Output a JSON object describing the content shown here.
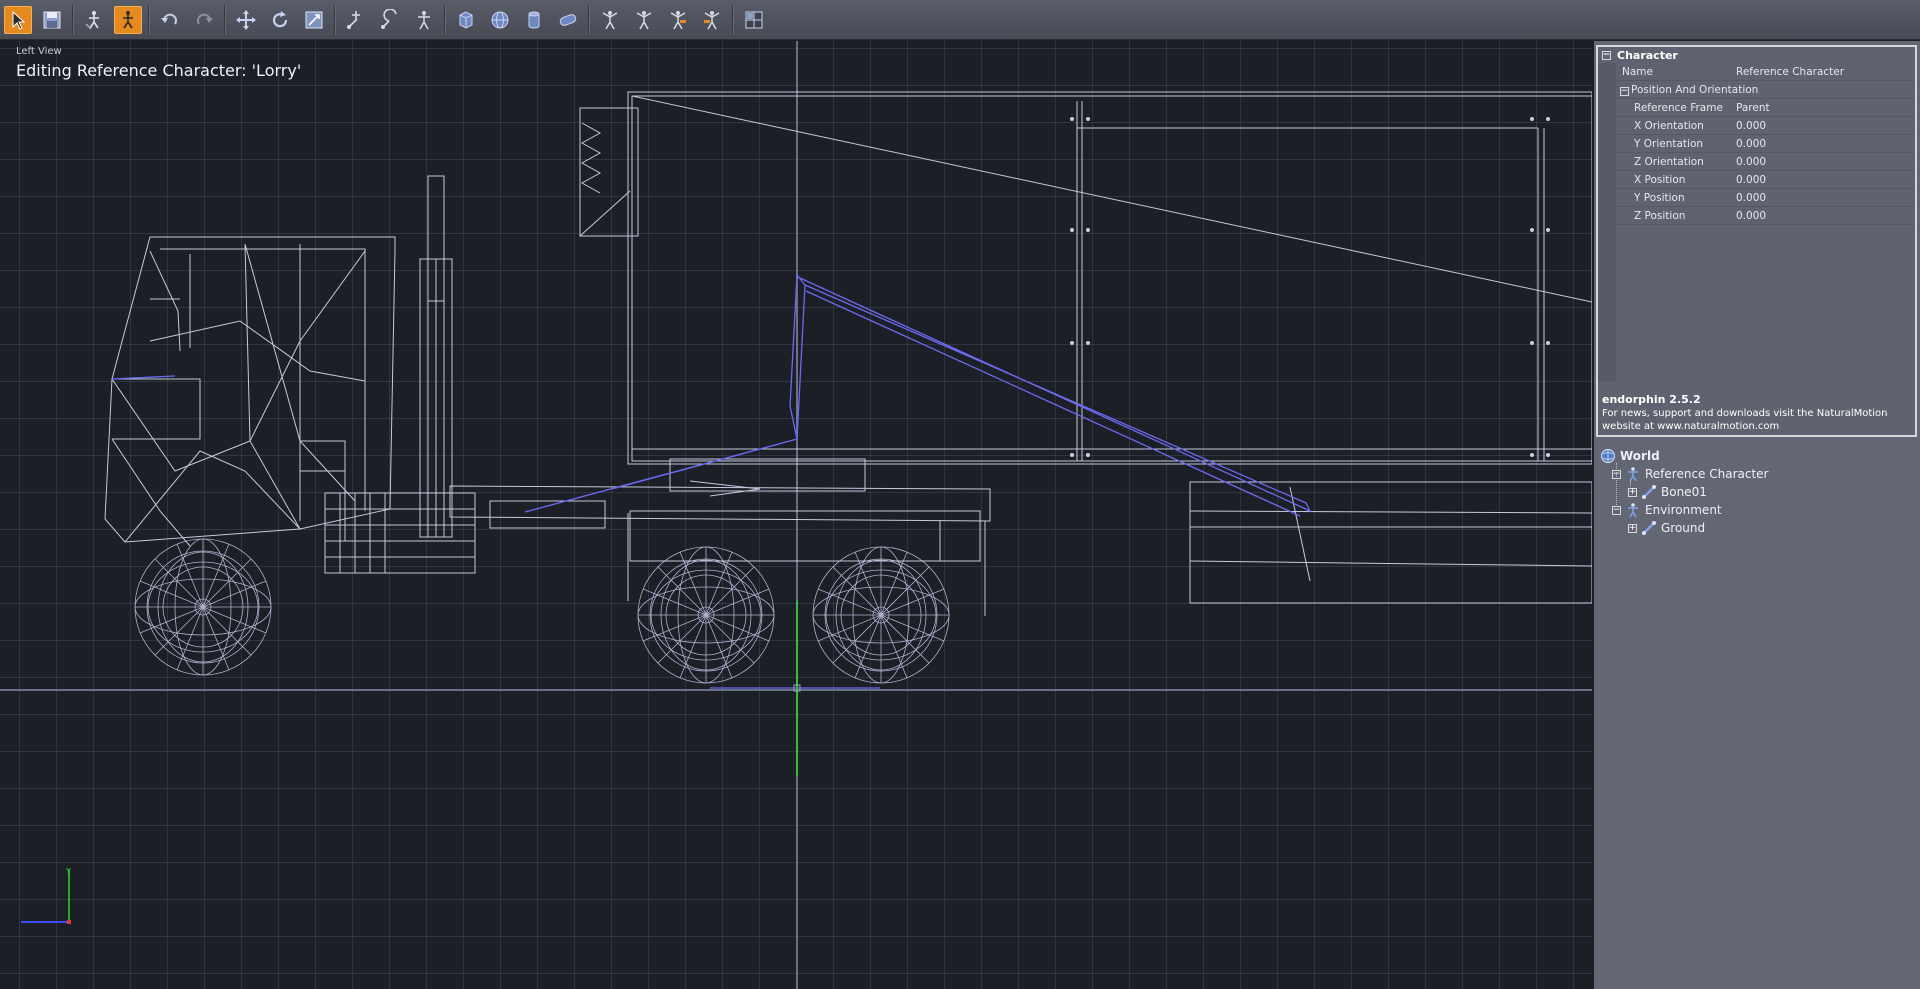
{
  "toolbar": {
    "buttons": [
      {
        "name": "select-tool-button",
        "icon": "arrow-cursor-icon",
        "active": true
      },
      {
        "name": "save-button",
        "icon": "floppy-disk-icon"
      },
      {
        "name": "character-edit-button",
        "icon": "figure-arrow-icon"
      },
      {
        "name": "reference-character-button",
        "icon": "figure-active-icon",
        "active": true
      },
      {
        "name": "undo-button",
        "icon": "undo-icon"
      },
      {
        "name": "redo-button",
        "icon": "redo-icon"
      },
      {
        "name": "translate-tool-button",
        "icon": "move-arrows-icon"
      },
      {
        "name": "rotate-tool-button",
        "icon": "rotate-icon"
      },
      {
        "name": "scale-tool-button",
        "icon": "scale-icon"
      },
      {
        "name": "bone-translate-button",
        "icon": "bone-move-icon"
      },
      {
        "name": "bone-rotate-button",
        "icon": "bone-rotate-icon"
      },
      {
        "name": "figure-pose-button",
        "icon": "figure-pose-icon"
      },
      {
        "name": "add-box-button",
        "icon": "box-icon"
      },
      {
        "name": "add-sphere-button",
        "icon": "sphere-icon"
      },
      {
        "name": "add-cylinder-button",
        "icon": "cylinder-icon"
      },
      {
        "name": "add-capsule-button",
        "icon": "capsule-icon"
      },
      {
        "name": "behaviour-1-button",
        "icon": "figure-arms-icon"
      },
      {
        "name": "behaviour-2-button",
        "icon": "figure-arms-icon"
      },
      {
        "name": "behaviour-3-button",
        "icon": "figure-arms-orange-icon"
      },
      {
        "name": "behaviour-4-button",
        "icon": "figure-arms-orange-icon"
      },
      {
        "name": "layout-button",
        "icon": "layout-icon"
      }
    ]
  },
  "viewport": {
    "view_label": "Left View",
    "title": "Editing Reference Character: 'Lorry'",
    "axis_y": "Y"
  },
  "properties": {
    "header": "Character",
    "name_label": "Name",
    "name_value": "Reference Character",
    "group_label": "Position And Orientation",
    "rows": [
      {
        "label": "Reference Frame",
        "value": "Parent"
      },
      {
        "label": "X Orientation",
        "value": "0.000"
      },
      {
        "label": "Y Orientation",
        "value": "0.000"
      },
      {
        "label": "Z Orientation",
        "value": "0.000"
      },
      {
        "label": "X Position",
        "value": "0.000"
      },
      {
        "label": "Y Position",
        "value": "0.000"
      },
      {
        "label": "Z Position",
        "value": "0.000"
      }
    ],
    "footer_title": "endorphin 2.5.2",
    "footer_line1": "For news, support and downloads visit the NaturalMotion",
    "footer_line2": "website at www.naturalmotion.com"
  },
  "scene_tree": {
    "root": "World",
    "reference_character": "Reference Character",
    "bone": "Bone01",
    "environment": "Environment",
    "ground": "Ground"
  },
  "colors": {
    "toolbar": "#4f525c",
    "active_button": "#e58a1f",
    "viewport_bg": "#1c1f26",
    "wireframe": "#d8dcf0",
    "skeleton": "#6b6bf0",
    "panel": "#636773"
  }
}
